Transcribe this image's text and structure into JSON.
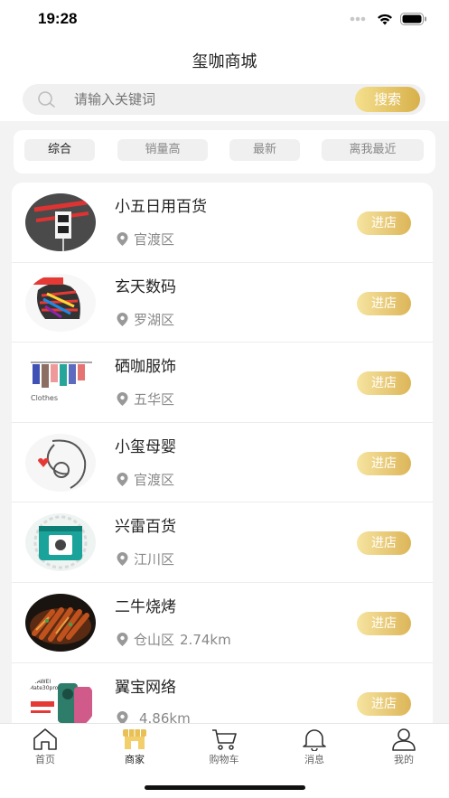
{
  "status_bar": {
    "time": "19:28"
  },
  "nav": {
    "title": "玺咖商城"
  },
  "search": {
    "placeholder": "请输入关键词",
    "button_label": "搜索"
  },
  "filters": [
    {
      "label": "综合",
      "active": true
    },
    {
      "label": "销量高",
      "active": false
    },
    {
      "label": "最新",
      "active": false
    },
    {
      "label": "离我最近",
      "active": false
    }
  ],
  "stores": [
    {
      "name": "小五日用百货",
      "location": "官渡区",
      "distance": "",
      "button": "进店",
      "thumb_icon": "grocery-sign-icon"
    },
    {
      "name": "玄天数码",
      "location": "罗湖区",
      "distance": "",
      "button": "进店",
      "thumb_icon": "zebra-logo-icon"
    },
    {
      "name": "硒咖服饰",
      "location": "五华区",
      "distance": "",
      "button": "进店",
      "thumb_icon": "clothes-rack-icon",
      "thumb_text": "Clothes"
    },
    {
      "name": "小玺母婴",
      "location": "官渡区",
      "distance": "",
      "button": "进店",
      "thumb_icon": "mother-baby-icon"
    },
    {
      "name": "兴雷百货",
      "location": "江川区",
      "distance": "",
      "button": "进店",
      "thumb_icon": "washing-machine-icon"
    },
    {
      "name": "二牛烧烤",
      "location": "仓山区",
      "distance": "2.74km",
      "button": "进店",
      "thumb_icon": "bbq-skewers-icon"
    },
    {
      "name": "翼宝网络",
      "location": "",
      "distance": "4.86km",
      "button": "进店",
      "thumb_icon": "phone-ad-icon",
      "thumb_text": "HUAWEI Mate30pro"
    }
  ],
  "tab_bar": [
    {
      "label": "首页",
      "icon": "home-icon",
      "active": false
    },
    {
      "label": "商家",
      "icon": "shop-icon",
      "active": true
    },
    {
      "label": "购物车",
      "icon": "cart-icon",
      "active": false
    },
    {
      "label": "消息",
      "icon": "bell-icon",
      "active": false
    },
    {
      "label": "我的",
      "icon": "user-icon",
      "active": false
    }
  ],
  "colors": {
    "accent_gold": "#d7b04a",
    "accent_gold_light": "#f5e08e",
    "background_gray": "#f3f3f3"
  }
}
